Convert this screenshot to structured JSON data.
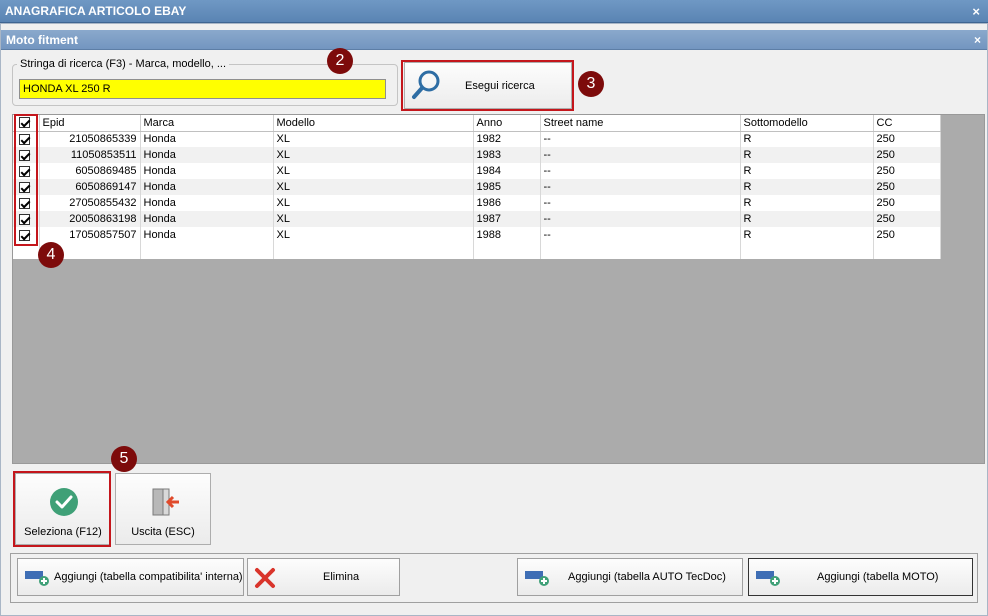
{
  "window": {
    "title": "ANAGRAFICA ARTICOLO EBAY",
    "close": "×"
  },
  "dialog": {
    "title": "Moto fitment",
    "close": "×"
  },
  "search": {
    "legend": "Stringa di ricerca (F3) - Marca, modello, ...",
    "value": "HONDA XL 250 R",
    "button_label": "Esegui ricerca"
  },
  "badges": {
    "b2": "2",
    "b3": "3",
    "b4": "4",
    "b5": "5"
  },
  "grid": {
    "columns": [
      "Epid",
      "Marca",
      "Modello",
      "Anno",
      "Street name",
      "Sottomodello",
      "CC"
    ],
    "rows": [
      {
        "epid": "21050865339",
        "marca": "Honda",
        "modello": "XL",
        "anno": "1982",
        "street": "--",
        "sotto": "R",
        "cc": "250"
      },
      {
        "epid": "11050853511",
        "marca": "Honda",
        "modello": "XL",
        "anno": "1983",
        "street": "--",
        "sotto": "R",
        "cc": "250"
      },
      {
        "epid": "6050869485",
        "marca": "Honda",
        "modello": "XL",
        "anno": "1984",
        "street": "--",
        "sotto": "R",
        "cc": "250"
      },
      {
        "epid": "6050869147",
        "marca": "Honda",
        "modello": "XL",
        "anno": "1985",
        "street": "--",
        "sotto": "R",
        "cc": "250"
      },
      {
        "epid": "27050855432",
        "marca": "Honda",
        "modello": "XL",
        "anno": "1986",
        "street": "--",
        "sotto": "R",
        "cc": "250"
      },
      {
        "epid": "20050863198",
        "marca": "Honda",
        "modello": "XL",
        "anno": "1987",
        "street": "--",
        "sotto": "R",
        "cc": "250"
      },
      {
        "epid": "17050857507",
        "marca": "Honda",
        "modello": "XL",
        "anno": "1988",
        "street": "--",
        "sotto": "R",
        "cc": "250"
      }
    ]
  },
  "actions": {
    "select": "Seleziona (F12)",
    "exit": "Uscita (ESC)"
  },
  "bottom": {
    "add_internal": "Aggiungi (tabella compatibilita' interna)",
    "delete": "Elimina",
    "add_auto": "Aggiungi (tabella AUTO TecDoc)",
    "add_moto": "Aggiungi (tabella MOTO)"
  },
  "colors": {
    "title_bar": "#5a84b3",
    "search_highlight": "#ffff00",
    "annotation_red": "#c4161c",
    "badge": "#7d0b0b",
    "check_green": "#3fa077"
  }
}
